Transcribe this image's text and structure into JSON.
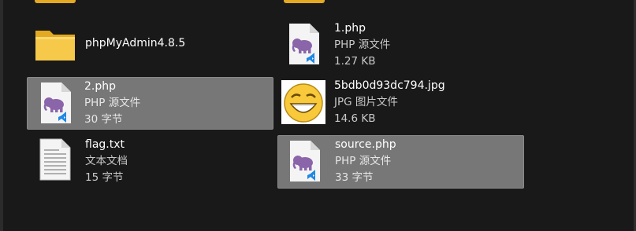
{
  "files": [
    {
      "id": "phpmyadmin",
      "name": "phpMyAdmin4.8.5",
      "type": "",
      "size": "",
      "icon": "folder-icon"
    },
    {
      "id": "one-php",
      "name": "1.php",
      "type": "PHP 源文件",
      "size": "1.27 KB",
      "icon": "php-file-icon"
    },
    {
      "id": "two-php",
      "name": "2.php",
      "type": "PHP 源文件",
      "size": "30 字节",
      "icon": "php-file-icon"
    },
    {
      "id": "jpg",
      "name": "5bdb0d93dc794.jpg",
      "type": "JPG 图片文件",
      "size": "14.6 KB",
      "icon": "smiley-thumbnail-icon"
    },
    {
      "id": "flag",
      "name": "flag.txt",
      "type": "文本文档",
      "size": "15 字节",
      "icon": "text-file-icon"
    },
    {
      "id": "source",
      "name": "source.php",
      "type": "PHP 源文件",
      "size": "33 字节",
      "icon": "php-file-icon"
    }
  ],
  "colors": {
    "background": "#191919",
    "selection": "#777777",
    "folder": "#f2c744",
    "php_elephant": "#8a65a9",
    "vscode_badge": "#1e88e5"
  }
}
